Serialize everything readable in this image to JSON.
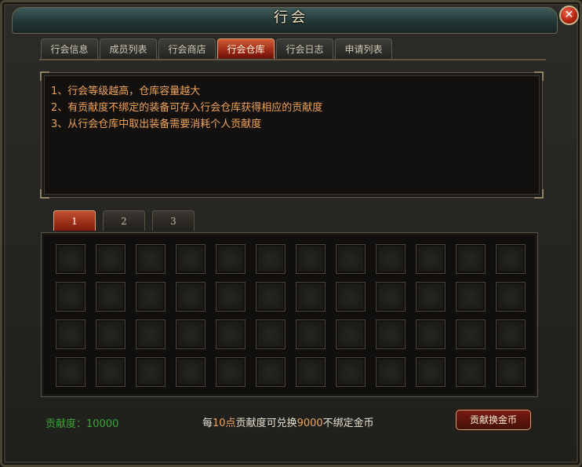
{
  "window": {
    "title": "行会"
  },
  "tabs": [
    {
      "label": "行会信息",
      "active": false
    },
    {
      "label": "成员列表",
      "active": false
    },
    {
      "label": "行会商店",
      "active": false
    },
    {
      "label": "行会仓库",
      "active": true
    },
    {
      "label": "行会日志",
      "active": false
    },
    {
      "label": "申请列表",
      "active": false
    }
  ],
  "info": {
    "rules": [
      "1、行会等级越高，仓库容量越大",
      "2、有贡献度不绑定的装备可存入行会仓库获得相应的贡献度",
      "3、从行会仓库中取出装备需要消耗个人贡献度"
    ]
  },
  "warehouse": {
    "pages": [
      "1",
      "2",
      "3"
    ],
    "active_page": "1",
    "rows": 4,
    "columns": 12
  },
  "footer": {
    "contribution_label": "贡献度：",
    "contribution_value": "10000",
    "exchange_parts": [
      "每",
      "10点",
      "贡献度可兑换",
      "9000",
      "不绑定金币"
    ],
    "exchange_button": "贡献换金币"
  },
  "colors": {
    "accent_orange": "#f0a35a",
    "contribution_green": "#3ea23a",
    "active_tab_red": "#b03a1e"
  }
}
